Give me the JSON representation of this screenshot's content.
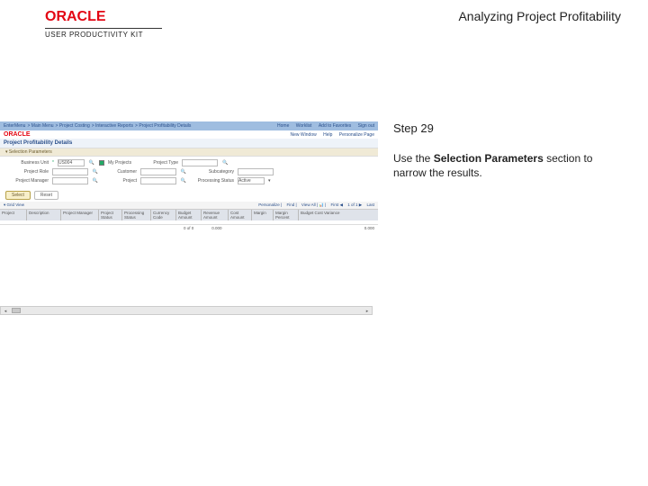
{
  "header": {
    "logo_text": "ORACLE",
    "kit_text": "USER PRODUCTIVITY KIT",
    "page_title": "Analyzing Project Profitability"
  },
  "instruction": {
    "step_label": "Step 29",
    "line1": "Use the ",
    "bold": "Selection Parameters",
    "line2": " section to narrow the results."
  },
  "shot": {
    "breadcrumb": {
      "items": [
        "EnterMenu",
        "Main Menu",
        "Project Costing",
        "Interactive Reports",
        "Project Profitability Details"
      ],
      "right": [
        "Home",
        "Worklist",
        "Add to Favorites",
        "Sign out"
      ]
    },
    "obar": {
      "brand": "ORACLE",
      "links": [
        "New Window",
        "Help",
        "Personalize Page"
      ]
    },
    "panel_title": "Project Profitability Details",
    "section_header": "Selection Parameters",
    "params": {
      "r1": [
        {
          "label": "Business Unit",
          "value": "US004"
        },
        {
          "label": "My Projects",
          "checked": true
        },
        {
          "label": "Project Type",
          "value": ""
        }
      ],
      "r2": [
        {
          "label": "Project Role",
          "value": ""
        },
        {
          "label": "Customer",
          "value": ""
        },
        {
          "label": "Subcategory",
          "value": ""
        }
      ],
      "r3": [
        {
          "label": "Project Manager",
          "value": ""
        },
        {
          "label": "Project",
          "value": ""
        },
        {
          "label": "Processing Status",
          "value": "Active"
        }
      ]
    },
    "buttons": {
      "select": "Select",
      "reset": "Reset"
    },
    "grid": {
      "view_label": "Grid View",
      "toolbar_right": [
        "Personalize",
        "Find",
        "View All",
        "First",
        "1 of 1",
        "Last"
      ],
      "cols": [
        "Project",
        "Description",
        "Project Manager",
        "Project Status",
        "Processing Status",
        "Currency Code",
        "Budget Amount",
        "Revenue Amount",
        "Cost Amount",
        "Margin",
        "Margin Percent",
        "Budget Cost Variance"
      ],
      "footer_total": "0 of 0",
      "footer_sum": "0.000",
      "footer_right": "0.000"
    }
  }
}
